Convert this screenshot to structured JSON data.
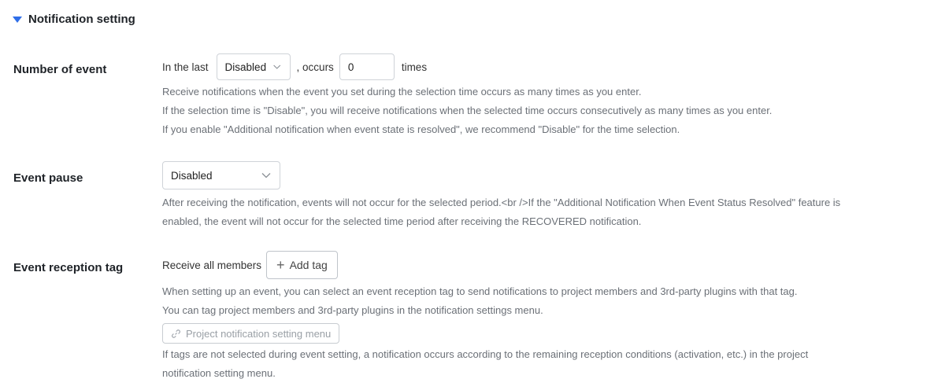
{
  "section": {
    "title": "Notification setting"
  },
  "number_of_event": {
    "label": "Number of event",
    "prefix": "In the last",
    "period_value": "Disabled",
    "occurs": ", occurs",
    "count_value": "0",
    "suffix": "times",
    "help": [
      "Receive notifications when the event you set during the selection time occurs as many times as you enter.",
      "If the selection time is \"Disable\", you will receive notifications when the selected time occurs consecutively as many times as you enter.",
      "If you enable \"Additional notification when event state is resolved\", we recommend \"Disable\" for the time selection."
    ]
  },
  "event_pause": {
    "label": "Event pause",
    "value": "Disabled",
    "help": [
      "After receiving the notification, events will not occur for the selected period.<br />If the \"Additional Notification When Event Status Resolved\" feature is",
      "enabled, the event will not occur for the selected time period after receiving the RECOVERED notification."
    ]
  },
  "event_reception_tag": {
    "label": "Event reception tag",
    "receive_text": "Receive all members",
    "add_tag_label": "Add tag",
    "help1": [
      "When setting up an event, you can select an event reception tag to send notifications to project members and 3rd-party plugins with that tag.",
      "You can tag project members and 3rd-party plugins in the notification settings menu."
    ],
    "link_button_label": "Project notification setting menu",
    "help2": [
      "If tags are not selected during event setting, a notification occurs according to the remaining reception conditions (activation, etc.) in the project",
      "notification setting menu."
    ]
  },
  "colors": {
    "accent": "#2f6ee8",
    "help_text": "#6b7077",
    "border": "#cfd3d8"
  },
  "icons": {
    "section_toggle": "triangle-down-icon",
    "select": "chevron-down-icon",
    "add": "plus-icon",
    "link": "link-icon"
  }
}
